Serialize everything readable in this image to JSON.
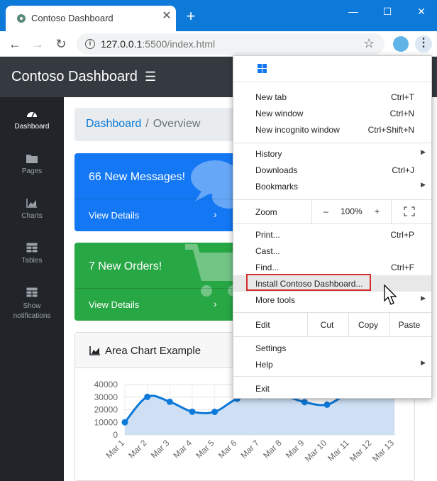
{
  "browser": {
    "tab_title": "Contoso Dashboard",
    "url_host": "127.0.0.1",
    "url_rest": ":5500/index.html",
    "accent": "#0d79d8"
  },
  "page": {
    "brand": "Contoso Dashboard",
    "breadcrumb": {
      "link": "Dashboard",
      "separator": "/",
      "current": "Overview"
    },
    "sidebar": [
      {
        "label": "Dashboard",
        "icon": "dashboard-icon",
        "active": true
      },
      {
        "label": "Pages",
        "icon": "folder-icon"
      },
      {
        "label": "Charts",
        "icon": "area-chart-icon"
      },
      {
        "label": "Tables",
        "icon": "table-icon"
      },
      {
        "label": "Show notifications",
        "label_line1": "Show",
        "label_line2": "notifications",
        "icon": "table-icon"
      }
    ],
    "cards": [
      {
        "title": "66 New Messages!",
        "details": "View Details",
        "color": "#1478f4"
      },
      {
        "title": "7 New Orders!",
        "details": "View Details",
        "color": "#28a745"
      }
    ],
    "chart_card_title": "Area Chart Example"
  },
  "chart_data": {
    "type": "area",
    "title": "Area Chart Example",
    "categories": [
      "Mar 1",
      "Mar 2",
      "Mar 3",
      "Mar 4",
      "Mar 5",
      "Mar 6",
      "Mar 7",
      "Mar 8",
      "Mar 9",
      "Mar 10",
      "Mar 11",
      "Mar 12",
      "Mar 13"
    ],
    "values": [
      10000,
      30200,
      26300,
      18400,
      18300,
      28700,
      31000,
      31500,
      26000,
      24000,
      33000,
      31500,
      38500
    ],
    "yticks": [
      "40000",
      "30000",
      "20000",
      "10000",
      "0"
    ],
    "ylim": [
      0,
      40000
    ],
    "line_color": "#0d79d8",
    "fill_color": "#cfe0f5",
    "grid": true
  },
  "menu": {
    "items_top": [
      {
        "label": "New tab",
        "shortcut": "Ctrl+T"
      },
      {
        "label": "New window",
        "shortcut": "Ctrl+N"
      },
      {
        "label": "New incognito window",
        "shortcut": "Ctrl+Shift+N"
      }
    ],
    "items_mid": [
      {
        "label": "History",
        "shortcut": "",
        "submenu": true
      },
      {
        "label": "Downloads",
        "shortcut": "Ctrl+J"
      },
      {
        "label": "Bookmarks",
        "shortcut": "",
        "submenu": true
      }
    ],
    "zoom": {
      "label": "Zoom",
      "minus": "–",
      "value": "100%",
      "plus": "+"
    },
    "items_tools": [
      {
        "label": "Print...",
        "shortcut": "Ctrl+P"
      },
      {
        "label": "Cast...",
        "shortcut": ""
      },
      {
        "label": "Find...",
        "shortcut": "Ctrl+F"
      },
      {
        "label": "Install Contoso Dashboard...",
        "shortcut": "",
        "highlighted": true
      },
      {
        "label": "More tools",
        "shortcut": "",
        "submenu": true
      }
    ],
    "edit": {
      "label": "Edit",
      "cut": "Cut",
      "copy": "Copy",
      "paste": "Paste"
    },
    "items_bottom": [
      {
        "label": "Settings",
        "shortcut": ""
      },
      {
        "label": "Help",
        "shortcut": "",
        "submenu": true
      }
    ],
    "exit": "Exit",
    "highlight_color": "#d42b2b"
  }
}
